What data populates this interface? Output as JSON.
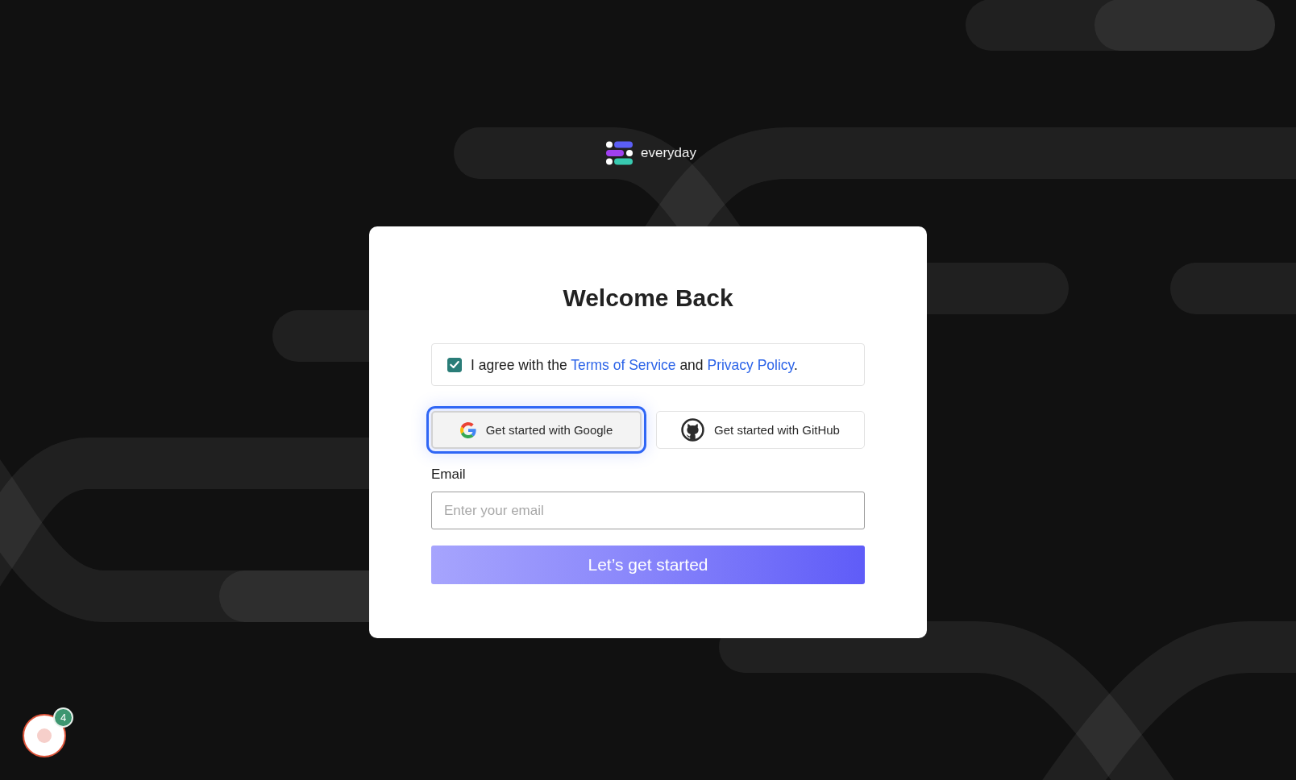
{
  "logo": {
    "name": "everyday"
  },
  "card": {
    "title": "Welcome Back",
    "agreement": {
      "checked": true,
      "parts": [
        {
          "kind": "text",
          "text": "I agree with the "
        },
        {
          "kind": "link",
          "text": "Terms of Service"
        },
        {
          "kind": "text",
          "text": " and "
        },
        {
          "kind": "link",
          "text": "Privacy Policy"
        },
        {
          "kind": "text",
          "text": "."
        }
      ]
    },
    "social_buttons": [
      {
        "kind": "google",
        "label": "Get started with Google",
        "focused": true
      },
      {
        "kind": "github",
        "label": "Get started with GitHub",
        "focused": false
      }
    ],
    "email": {
      "label": "Email",
      "placeholder": "Enter your email"
    },
    "submit": {
      "label": "Let’s get started"
    }
  },
  "floating_widget": {
    "badge": "4"
  }
}
